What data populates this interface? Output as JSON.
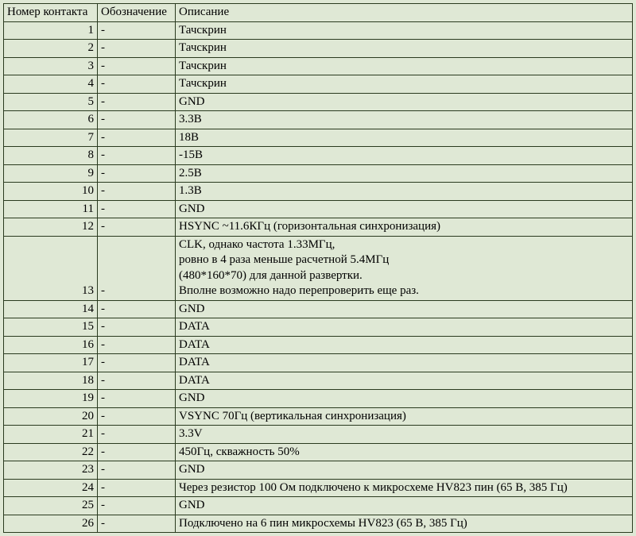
{
  "headers": {
    "num": "Номер контакта",
    "desig": "Обозначение",
    "desc": "Описание"
  },
  "rows": [
    {
      "num": "1",
      "desig": "-",
      "desc": "Тачскрин"
    },
    {
      "num": "2",
      "desig": "-",
      "desc": "Тачскрин"
    },
    {
      "num": "3",
      "desig": "-",
      "desc": "Тачскрин"
    },
    {
      "num": "4",
      "desig": "-",
      "desc": "Тачскрин"
    },
    {
      "num": "5",
      "desig": "-",
      "desc": "GND"
    },
    {
      "num": "6",
      "desig": "-",
      "desc": "3.3В"
    },
    {
      "num": "7",
      "desig": "-",
      "desc": "18В"
    },
    {
      "num": "8",
      "desig": "-",
      "desc": "-15В"
    },
    {
      "num": "9",
      "desig": "-",
      "desc": "2.5В"
    },
    {
      "num": "10",
      "desig": "-",
      "desc": "1.3В"
    },
    {
      "num": "11",
      "desig": "-",
      "desc": "GND"
    },
    {
      "num": "12",
      "desig": "-",
      "desc": "HSYNC ~11.6КГц (горизонтальная синхронизация)"
    },
    {
      "num": "13",
      "desig": "-",
      "desc": "CLK, однако частота 1.33МГц,\nровно в 4 раза меньше расчетной 5.4МГц\n(480*160*70) для данной развертки.\nВполне возможно надо перепроверить еще раз."
    },
    {
      "num": "14",
      "desig": "-",
      "desc": "GND"
    },
    {
      "num": "15",
      "desig": "-",
      "desc": "DATA"
    },
    {
      "num": "16",
      "desig": "-",
      "desc": "DATA"
    },
    {
      "num": "17",
      "desig": "-",
      "desc": "DATA"
    },
    {
      "num": "18",
      "desig": "-",
      "desc": "DATA"
    },
    {
      "num": "19",
      "desig": "-",
      "desc": "GND"
    },
    {
      "num": "20",
      "desig": "-",
      "desc": "VSYNC 70Гц (вертикальная синхронизация)"
    },
    {
      "num": "21",
      "desig": "-",
      "desc": "3.3V"
    },
    {
      "num": "22",
      "desig": "-",
      "desc": "450Гц, скважность 50%"
    },
    {
      "num": "23",
      "desig": "-",
      "desc": "GND"
    },
    {
      "num": "24",
      "desig": "-",
      "desc": "Через резистор 100 Ом подключено к микросхеме HV823  пин (65 В, 385 Гц)"
    },
    {
      "num": "25",
      "desig": "-",
      "desc": "GND"
    },
    {
      "num": "26",
      "desig": "-",
      "desc": "Подключено на 6 пин микросхемы HV823 (65 В, 385 Гц)"
    }
  ]
}
